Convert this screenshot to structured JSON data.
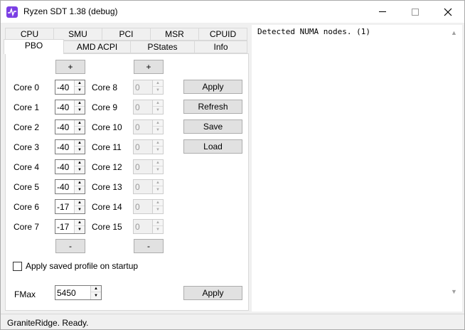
{
  "window": {
    "title": "Ryzen SDT 1.38 (debug)",
    "icon": "app-icon"
  },
  "tabs_row1": [
    "CPU",
    "SMU",
    "PCI",
    "MSR",
    "CPUID"
  ],
  "tabs_row2": [
    "PBO",
    "AMD ACPI",
    "PStates",
    "Info"
  ],
  "active_tab": "PBO",
  "pbo": {
    "plus_label": "+",
    "minus_label": "-",
    "cores_left": [
      {
        "label": "Core 0",
        "value": "-40"
      },
      {
        "label": "Core 1",
        "value": "-40"
      },
      {
        "label": "Core 2",
        "value": "-40"
      },
      {
        "label": "Core 3",
        "value": "-40"
      },
      {
        "label": "Core 4",
        "value": "-40"
      },
      {
        "label": "Core 5",
        "value": "-40"
      },
      {
        "label": "Core 6",
        "value": "-17"
      },
      {
        "label": "Core 7",
        "value": "-17"
      }
    ],
    "cores_right": [
      {
        "label": "Core 8",
        "value": "0"
      },
      {
        "label": "Core 9",
        "value": "0"
      },
      {
        "label": "Core 10",
        "value": "0"
      },
      {
        "label": "Core 11",
        "value": "0"
      },
      {
        "label": "Core 12",
        "value": "0"
      },
      {
        "label": "Core 13",
        "value": "0"
      },
      {
        "label": "Core 14",
        "value": "0"
      },
      {
        "label": "Core 15",
        "value": "0"
      }
    ],
    "buttons": {
      "apply": "Apply",
      "refresh": "Refresh",
      "save": "Save",
      "load": "Load"
    },
    "startup_checkbox_label": "Apply saved profile on startup",
    "startup_checked": false,
    "fmax_label": "FMax",
    "fmax_value": "5450",
    "fmax_apply": "Apply"
  },
  "log": {
    "text": "Detected NUMA nodes. (1)"
  },
  "status": {
    "text": "GraniteRidge. Ready."
  }
}
